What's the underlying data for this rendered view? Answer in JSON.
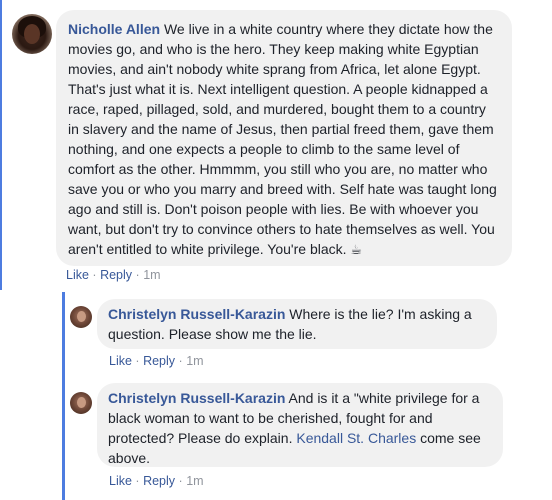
{
  "comments": [
    {
      "author": "Nicholle Allen",
      "text": "We live in a white country where they dictate how the movies go, and who is the hero. They keep making white Egyptian movies, and ain't nobody white sprang from Africa, let alone Egypt. That's just what it is. Next intelligent question. A people kidnapped a race, raped, pillaged, sold, and murdered, bought them to a country in slavery and the name of Jesus, then partial freed them, gave them nothing, and one expects a people to climb to the same level of comfort as the other. Hmmmm, you still who you are, no matter who save you or who you marry and breed with. Self hate was taught long ago and still is. Don't poison people with lies. Be with whoever you want, but don't try to convince others to hate themselves as well. You aren't entitled to white privilege. You're black.",
      "emoji": "☕",
      "like_label": "Like",
      "reply_label": "Reply",
      "separator": "·",
      "time": "1m"
    },
    {
      "author": "Christelyn Russell-Karazin",
      "text": "Where is the lie? I'm asking a question. Please show me the lie.",
      "like_label": "Like",
      "reply_label": "Reply",
      "separator": "·",
      "time": "1m"
    },
    {
      "author": "Christelyn Russell-Karazin",
      "text_before": "And is it a \"white privilege for a black woman to want to be cherished, fought for and protected? Please do explain.",
      "mention": "Kendall St. Charles",
      "text_after": "come see above.",
      "like_label": "Like",
      "reply_label": "Reply",
      "separator": "·",
      "time": "1m"
    }
  ],
  "colors": {
    "accent": "#385898",
    "thread_line": "#4d7ce0",
    "bubble": "#f1f1f1",
    "meta": "#90949c"
  }
}
